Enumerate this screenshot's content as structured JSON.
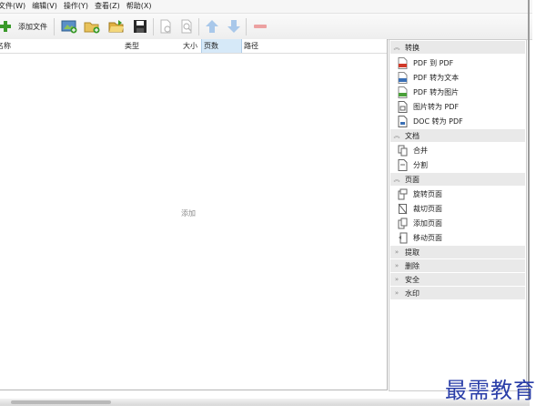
{
  "menubar": {
    "items": [
      {
        "label": "文件(W)"
      },
      {
        "label": "编辑(V)"
      },
      {
        "label": "操作(Y)"
      },
      {
        "label": "查看(Z)"
      },
      {
        "label": "帮助(X)"
      }
    ]
  },
  "toolbar": {
    "add_file_label": "添加文件",
    "icons": [
      "add-image-icon",
      "add-folder-icon",
      "open-folder-icon",
      "save-icon",
      "page-settings-icon",
      "preview-icon",
      "move-up-icon",
      "move-down-icon",
      "remove-icon"
    ]
  },
  "file_table": {
    "columns": {
      "name": "名称",
      "type": "类型",
      "size": "大小",
      "pages": "页数",
      "path": "路径"
    },
    "empty_hint": "添加"
  },
  "sidebar": {
    "convert": {
      "title": "转换",
      "items": [
        {
          "label": "PDF 到 PDF"
        },
        {
          "label": "PDF 转为文本"
        },
        {
          "label": "PDF 转为图片"
        },
        {
          "label": "图片转为 PDF"
        },
        {
          "label": "DOC 转为 PDF"
        }
      ]
    },
    "document": {
      "title": "文档",
      "items": [
        {
          "label": "合并"
        },
        {
          "label": "分割"
        }
      ]
    },
    "page": {
      "title": "页面",
      "items": [
        {
          "label": "旋转页面"
        },
        {
          "label": "裁切页面"
        },
        {
          "label": "添加页面"
        },
        {
          "label": "移动页面"
        }
      ]
    },
    "collapsed": [
      {
        "title": "提取"
      },
      {
        "title": "删除"
      },
      {
        "title": "安全"
      },
      {
        "title": "水印"
      }
    ]
  },
  "watermark": "最需教育",
  "colors": {
    "accent": "#2a3ea8",
    "selected_header": "#d6e9f8",
    "section_bg": "#e9e9e9"
  }
}
